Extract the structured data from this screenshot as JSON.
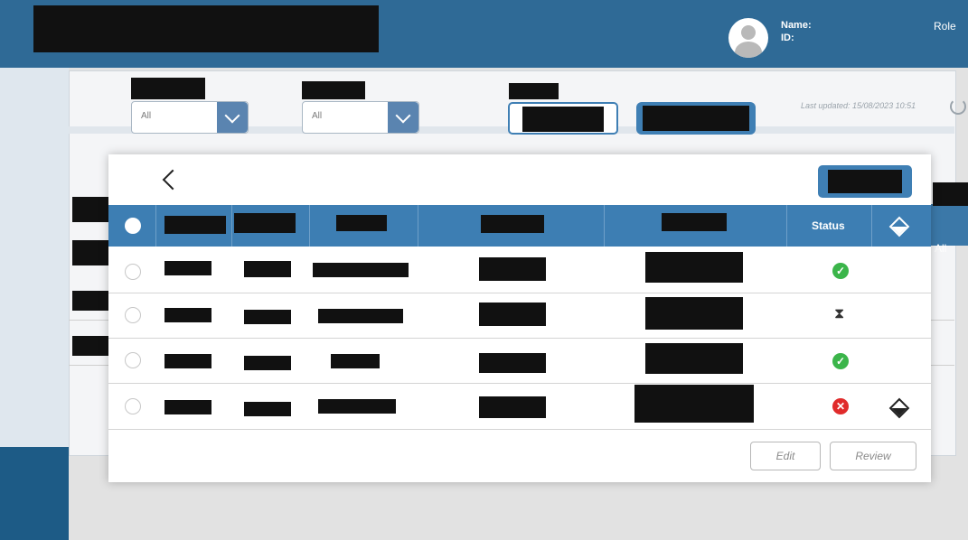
{
  "header": {
    "user_name_label": "Name:",
    "user_id_label": "ID:",
    "role_label": "Role"
  },
  "filters": {
    "filter1_value": "All",
    "filter2_value": "All",
    "last_updated": "Last updated: 15/08/2023 10:51"
  },
  "background_table": {
    "filter_value": "All"
  },
  "modal": {
    "status_header": "Status",
    "rows": [
      {
        "status": "approved"
      },
      {
        "status": "pending"
      },
      {
        "status": "approved"
      },
      {
        "status": "rejected"
      }
    ],
    "edit_label": "Edit",
    "review_label": "Review"
  },
  "colors": {
    "header_blue": "#3d7eb3",
    "ok_green": "#3bb54a",
    "error_red": "#e02b2b"
  },
  "icons": {
    "status_ok": "check-circle-icon",
    "status_pending": "hourglass-icon",
    "status_error": "x-circle-icon",
    "clear": "eraser-icon"
  }
}
